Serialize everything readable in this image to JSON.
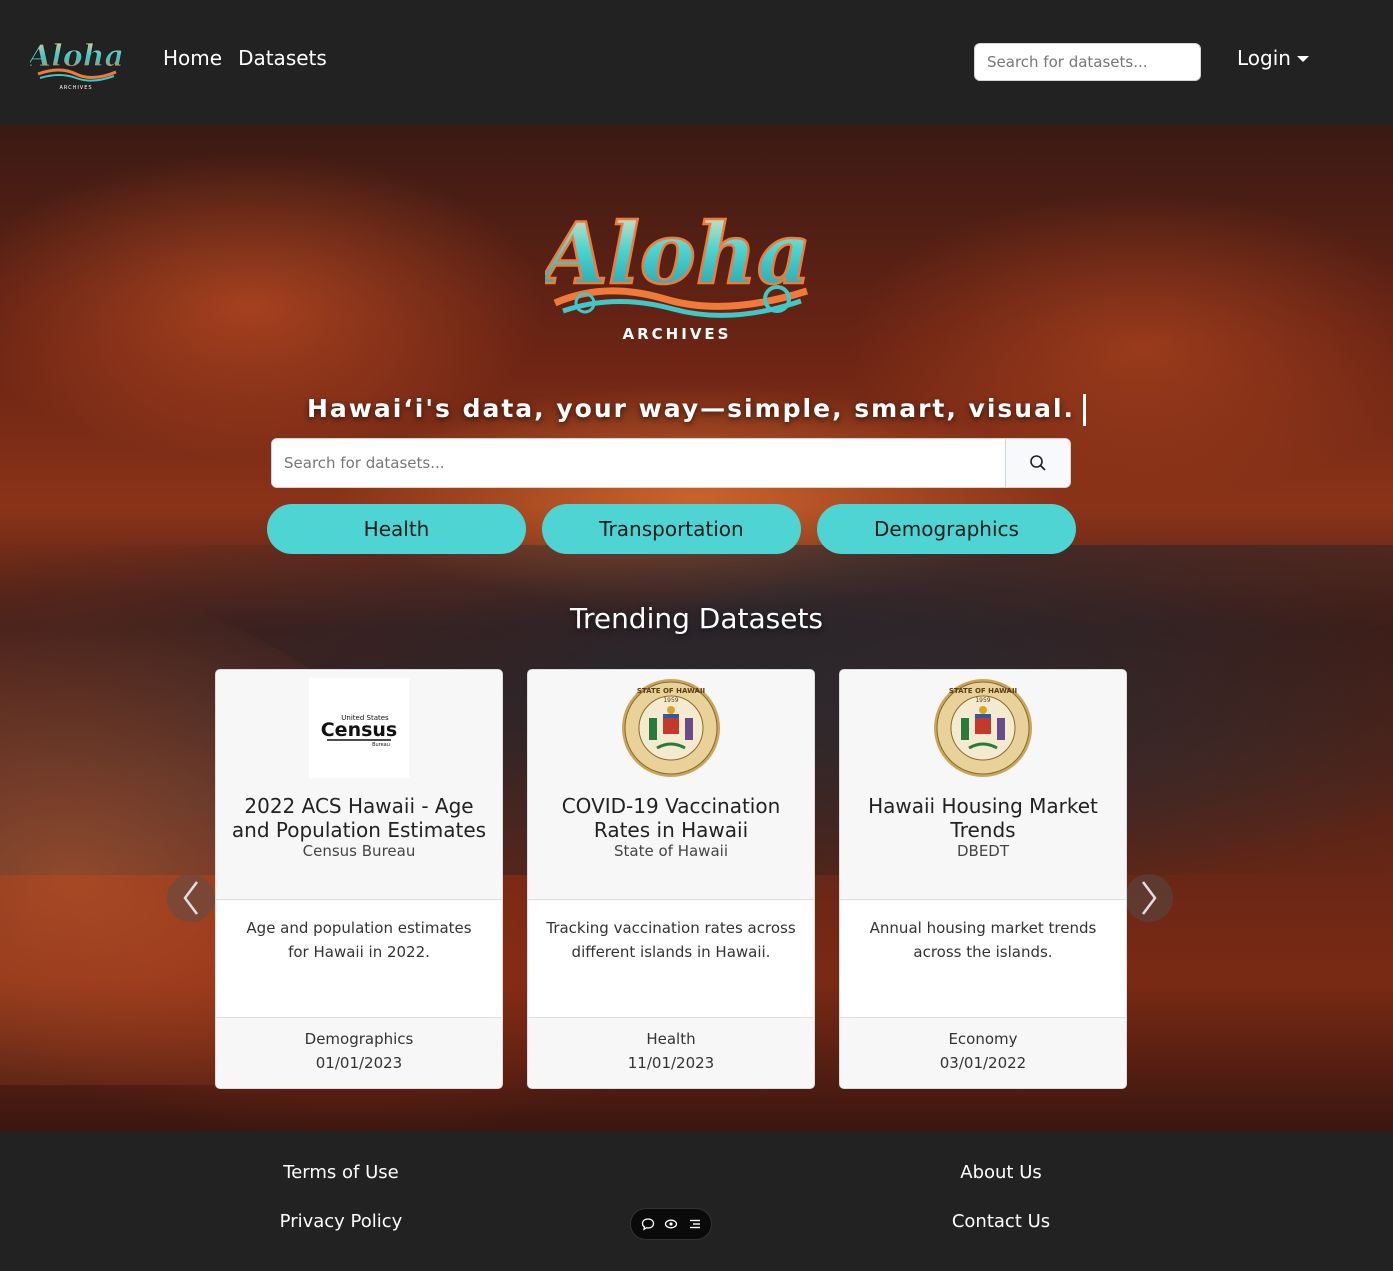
{
  "navbar": {
    "logo_text": "Aloha",
    "logo_sub": "ARCHIVES",
    "links": [
      "Home",
      "Datasets"
    ],
    "search_placeholder": "Search for datasets...",
    "login_label": "Login"
  },
  "hero": {
    "logo_text": "Aloha",
    "logo_sub": "ARCHIVES",
    "tagline": "Hawai‘i's data, your way—simple, smart, visual.",
    "search_placeholder": "Search for datasets...",
    "categories": [
      "Health",
      "Transportation",
      "Demographics"
    ],
    "trending_title": "Trending Datasets"
  },
  "cards": [
    {
      "logo": "census-logo",
      "logo_text_top": "United States",
      "logo_text_main": "Census",
      "logo_text_bottom": "Bureau",
      "title": "2022 ACS Hawaii - Age and Population Estimates",
      "source": "Census Bureau",
      "description": "Age and population estimates for Hawaii in 2022.",
      "category": "Demographics",
      "date": "01/01/2023"
    },
    {
      "logo": "hawaii-state-seal",
      "seal_top": "STATE OF HAWAII",
      "seal_year": "1959",
      "title": "COVID-19 Vaccination Rates in Hawaii",
      "source": "State of Hawaii",
      "description": "Tracking vaccination rates across different islands in Hawaii.",
      "category": "Health",
      "date": "11/01/2023"
    },
    {
      "logo": "hawaii-state-seal",
      "seal_top": "STATE OF HAWAII",
      "seal_year": "1959",
      "title": "Hawaii Housing Market Trends",
      "source": "DBEDT",
      "description": "Annual housing market trends across the islands.",
      "category": "Economy",
      "date": "03/01/2022"
    }
  ],
  "footer": {
    "terms": "Terms of Use",
    "privacy": "Privacy Policy",
    "about": "About Us",
    "contact": "Contact Us"
  },
  "colors": {
    "nav_bg": "#222222",
    "pill": "#4fd4d4",
    "logo_teal": "#3ec8c8",
    "logo_orange": "#f07a3a"
  }
}
